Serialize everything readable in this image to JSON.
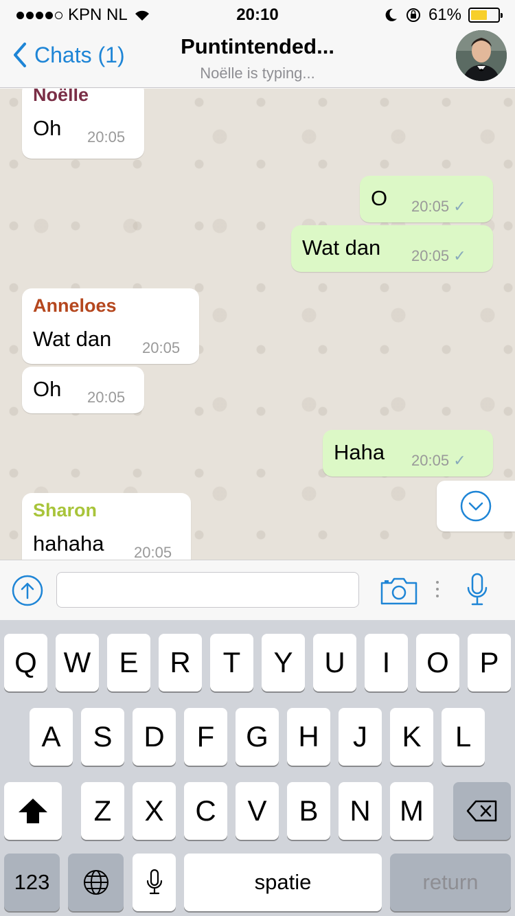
{
  "status_bar": {
    "carrier": "KPN NL",
    "time": "20:10",
    "battery_percent": "61%",
    "battery_level": 0.61
  },
  "nav": {
    "back_label": "Chats (1)",
    "title": "Puntintended...",
    "subtitle": "Noëlle is typing..."
  },
  "messages": [
    {
      "sender": "Noëlle",
      "text": "Oh",
      "time": "20:05",
      "dir": "in"
    },
    {
      "text": "O",
      "time": "20:05",
      "dir": "out"
    },
    {
      "text": "Wat dan",
      "time": "20:05",
      "dir": "out"
    },
    {
      "sender": "Anneloes",
      "text": "Wat dan",
      "time": "20:05",
      "dir": "in"
    },
    {
      "text": "Oh",
      "time": "20:05",
      "dir": "in"
    },
    {
      "text": "Haha",
      "time": "20:05",
      "dir": "out"
    },
    {
      "sender": "Sharon",
      "text": "hahaha",
      "time": "20:05",
      "dir": "in"
    }
  ],
  "sender_colors": {
    "Noëlle": "#7a2e46",
    "Anneloes": "#b5471e",
    "Sharon": "#a8c43a"
  },
  "colors": {
    "accent": "#1e85d6",
    "outgoing_bubble": "#dcf8c6",
    "incoming_bubble": "#ffffff"
  },
  "input": {
    "placeholder": "",
    "value": ""
  },
  "keyboard": {
    "row1": [
      "Q",
      "W",
      "E",
      "R",
      "T",
      "Y",
      "U",
      "I",
      "O",
      "P"
    ],
    "row2": [
      "A",
      "S",
      "D",
      "F",
      "G",
      "H",
      "J",
      "K",
      "L"
    ],
    "row3": [
      "Z",
      "X",
      "C",
      "V",
      "B",
      "N",
      "M"
    ],
    "numbers_label": "123",
    "space_label": "spatie",
    "return_label": "return"
  }
}
